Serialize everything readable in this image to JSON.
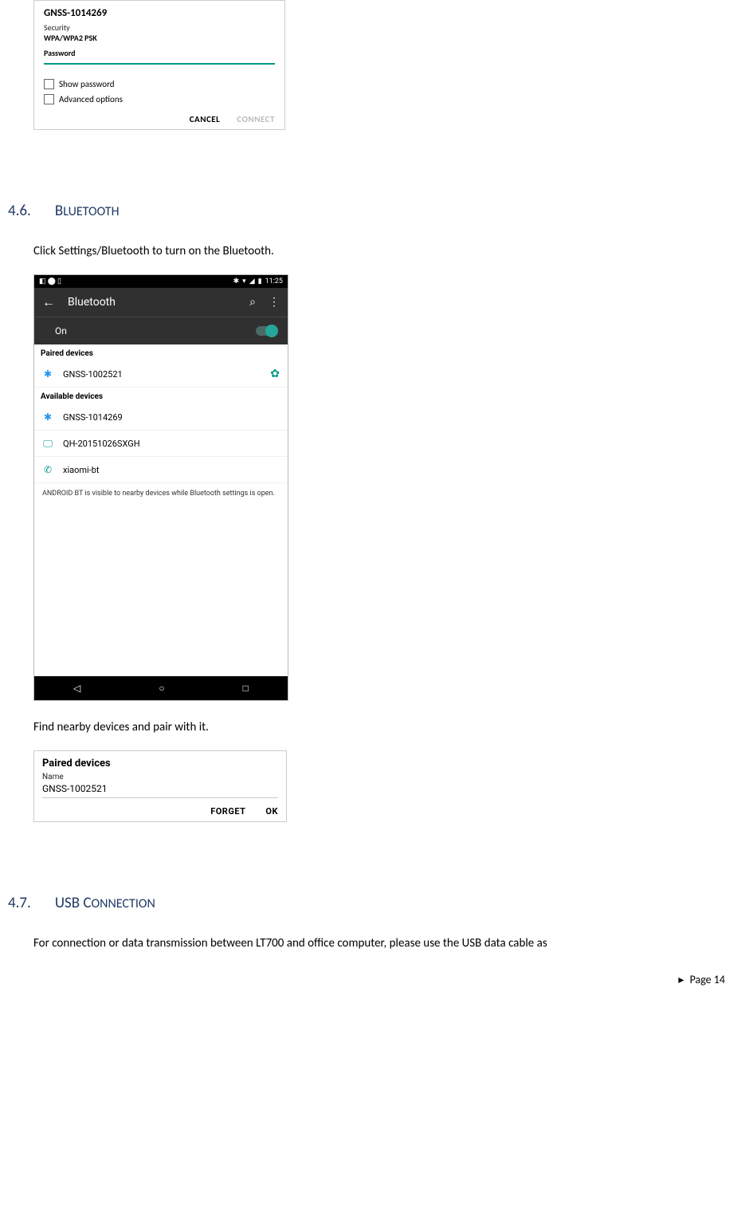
{
  "wifi_dialog": {
    "title": "GNSS-1014269",
    "security_label": "Security",
    "security_value": "WPA/WPA2 PSK",
    "password_label": "Password",
    "show_password": "Show password",
    "advanced_options": "Advanced options",
    "cancel": "CANCEL",
    "connect": "CONNECT"
  },
  "section_46": {
    "num": "4.6.",
    "title": "Bluetooth",
    "intro": "Click Settings/Bluetooth to turn on the Bluetooth.",
    "outro": "Find nearby devices and pair with it."
  },
  "bt_screen": {
    "status_time": "11:25",
    "header_title": "Bluetooth",
    "on_label": "On",
    "paired_label": "Paired devices",
    "paired_device": "GNSS-1002521",
    "available_label": "Available devices",
    "available": [
      {
        "icon": "bt",
        "name": "GNSS-1014269"
      },
      {
        "icon": "laptop",
        "name": "QH-20151026SXGH"
      },
      {
        "icon": "phone",
        "name": "xiaomi-bt"
      }
    ],
    "note": "ANDROID BT is visible to nearby devices while Bluetooth settings is open."
  },
  "paired_dialog": {
    "title": "Paired devices",
    "name_label": "Name",
    "name_value": "GNSS-1002521",
    "forget": "FORGET",
    "ok": "OK"
  },
  "section_47": {
    "num": "4.7.",
    "title": "USB Connection",
    "body": "For connection or data transmission between LT700 and office computer, please use the USB data cable as"
  },
  "footer": {
    "page": "Page 14"
  }
}
